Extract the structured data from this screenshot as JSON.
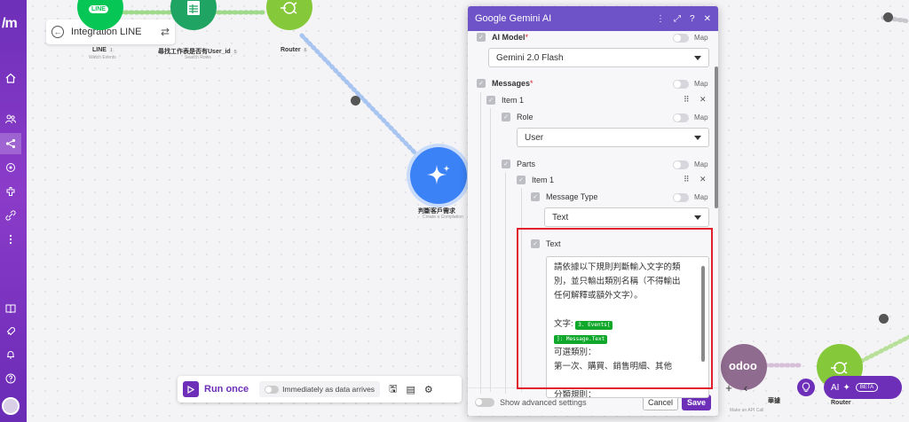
{
  "scenario": {
    "title": "Integration LINE"
  },
  "modules": {
    "line": {
      "logo_text": "LINE",
      "label": "LINE",
      "badge": "1",
      "sub": "Watch Events"
    },
    "sheets": {
      "label": "尋找工作表是否有User_id",
      "badge": "5",
      "sub": "Search Rows"
    },
    "router_top": {
      "label": "Router",
      "badge": "6"
    },
    "gemini": {
      "label": "判斷客戶需求",
      "sub": "Create a Completion"
    },
    "odoo": {
      "logo_text": "odoo",
      "sub": "Make an API Call"
    },
    "router_bottom": {
      "label": "Router"
    },
    "hidden_label": "華據"
  },
  "dialog": {
    "title": "Google Gemini AI",
    "header_icons": [
      "more-icon",
      "expand-icon",
      "help-icon",
      "close-icon"
    ],
    "ai_model": {
      "label": "AI Model",
      "required": "*",
      "map": "Map",
      "value": "Gemini 2.0 Flash"
    },
    "messages": {
      "label": "Messages",
      "required": "*",
      "map": "Map",
      "item_label": "Item 1",
      "role": {
        "label": "Role",
        "map": "Map",
        "value": "User"
      },
      "parts": {
        "label": "Parts",
        "map": "Map",
        "item_label": "Item 1",
        "message_type": {
          "label": "Message Type",
          "map": "Map",
          "value": "Text"
        },
        "text": {
          "label": "Text",
          "line1": "請依據以下規則判斷輸入文字的類",
          "line2": "別，並只輸出類別名稱（不得輸出",
          "line3": "任何解釋或額外文字）。",
          "line4_prefix": "文字:",
          "pill1": "3. Events[",
          "pill2": "]: Message.Text",
          "line5": "可選類別：",
          "line6": "第一次、購買、銷售明細、其他",
          "line7": "分類規則："
        }
      }
    },
    "footer": {
      "advanced": "Show advanced settings",
      "cancel": "Cancel",
      "save": "Save"
    }
  },
  "toolbar": {
    "run_once": "Run once",
    "schedule": "Immediately as data arrives"
  },
  "ai_assistant": {
    "label": "AI",
    "beta": "BETA"
  },
  "colors": {
    "brand": "#6d2fb8",
    "dialog_header": "#6d53c7",
    "line_green": "#06c755",
    "sheets_green": "#1fa463",
    "router_green": "#85c93a",
    "gemini_blue": "#3b82f6",
    "odoo_purple": "#8f6b8f",
    "highlight_red": "#e0202b"
  }
}
